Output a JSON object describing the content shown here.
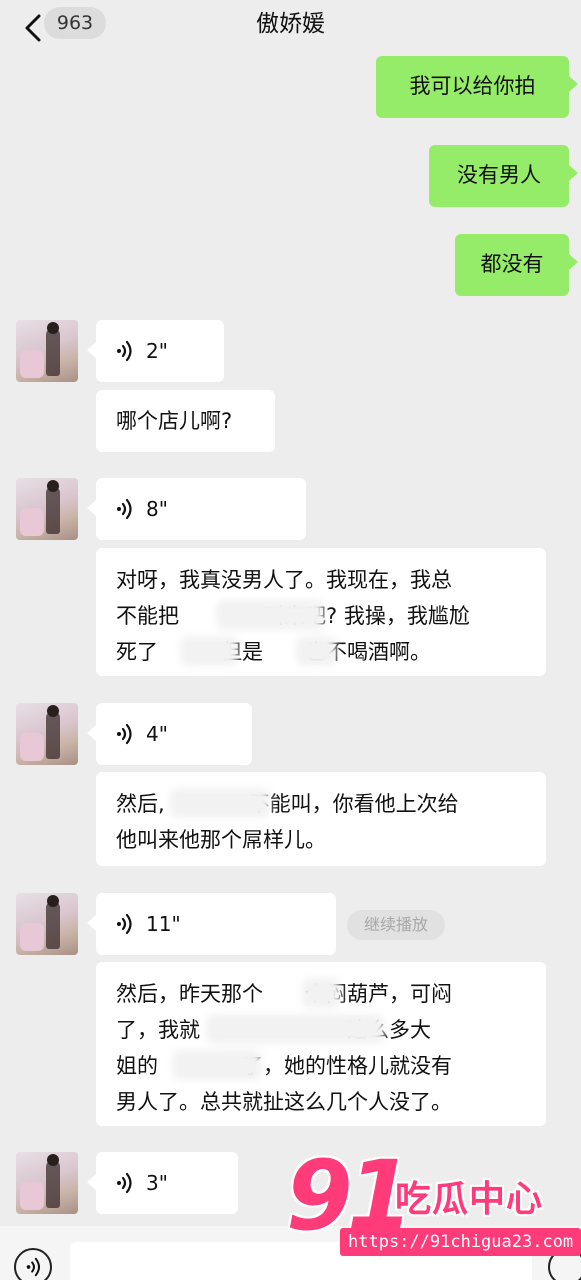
{
  "header": {
    "unread_count": "963",
    "contact_name": "傲娇媛"
  },
  "colors": {
    "sent_bubble": "#95ec69",
    "recv_bubble": "#ffffff",
    "background": "#ededed",
    "watermark": "#ff3b7a"
  },
  "messages": {
    "sent": [
      "我可以给你拍",
      "没有男人",
      "都没有"
    ],
    "voice": [
      "2\"",
      "8\"",
      "4\"",
      "11\"",
      "3\""
    ],
    "text": [
      "哪个店儿啊?",
      [
        "对呀，我真没男人了。我现在，我总",
        "不能把　　　　叫来吧? 我操，我尴尬",
        "死了　　　但是　　也不喝酒啊。"
      ],
      [
        "然后,　　　　不能叫，你看他上次给",
        "他叫来他那个屌样儿。"
      ],
      [
        "然后，昨天那个　　个闷葫芦，可闷",
        "了，我就　　　　　　　这么多大",
        "姐的　　　　了，她的性格儿就没有",
        "男人了。总共就扯这么几个人没了。"
      ]
    ]
  },
  "continue_label": "继续播放",
  "watermark": {
    "number": "91",
    "brand": "吃瓜中心",
    "url": "https://91chigua23.com"
  },
  "icons": {
    "back": "chevron-left-icon",
    "voice": "voice-wave-icon",
    "emoji": "emoji-icon"
  }
}
